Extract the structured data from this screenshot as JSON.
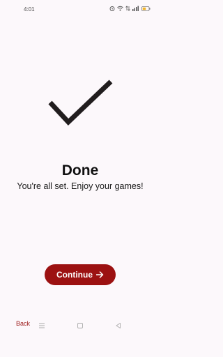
{
  "status_bar": {
    "time": "4:01",
    "icons": [
      "alarm-icon",
      "wifi-icon",
      "data-icon",
      "signal-icon",
      "battery-icon"
    ],
    "battery_color": "#f0b429"
  },
  "main": {
    "icon": "checkmark-icon",
    "title": "Done",
    "subtitle": "You're all set. Enjoy your games!"
  },
  "continue_button": {
    "label": "Continue",
    "icon": "arrow-right-icon",
    "color": "#9c1111"
  },
  "back_link": {
    "label": "Back",
    "color": "#9c1a1a"
  },
  "navigation_bar": {
    "icons": [
      "menu-icon",
      "home-icon",
      "back-icon"
    ]
  }
}
